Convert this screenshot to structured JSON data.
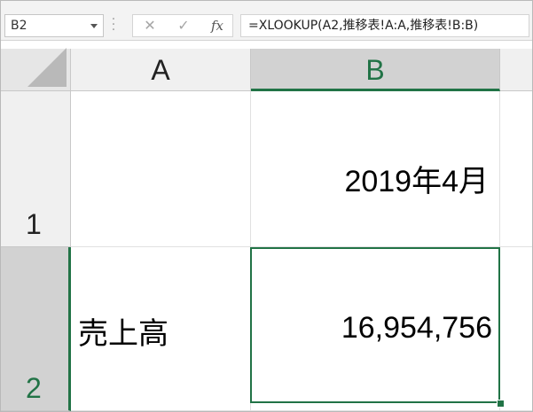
{
  "formula_bar": {
    "name_box": "B2",
    "cancel_icon": "✕",
    "enter_icon": "✓",
    "fx_label": "fx",
    "formula": "=XLOOKUP(A2,推移表!A:A,推移表!B:B)"
  },
  "columns": [
    "A",
    "B"
  ],
  "rows": [
    "1",
    "2"
  ],
  "cells": {
    "A1": "",
    "B1": "2019年4月",
    "A2": "売上高",
    "B2": "16,954,756"
  },
  "active_cell": "B2",
  "colors": {
    "accent": "#217346",
    "header_bg": "#f0f0f0",
    "selected_header_bg": "#d2d2d2"
  }
}
